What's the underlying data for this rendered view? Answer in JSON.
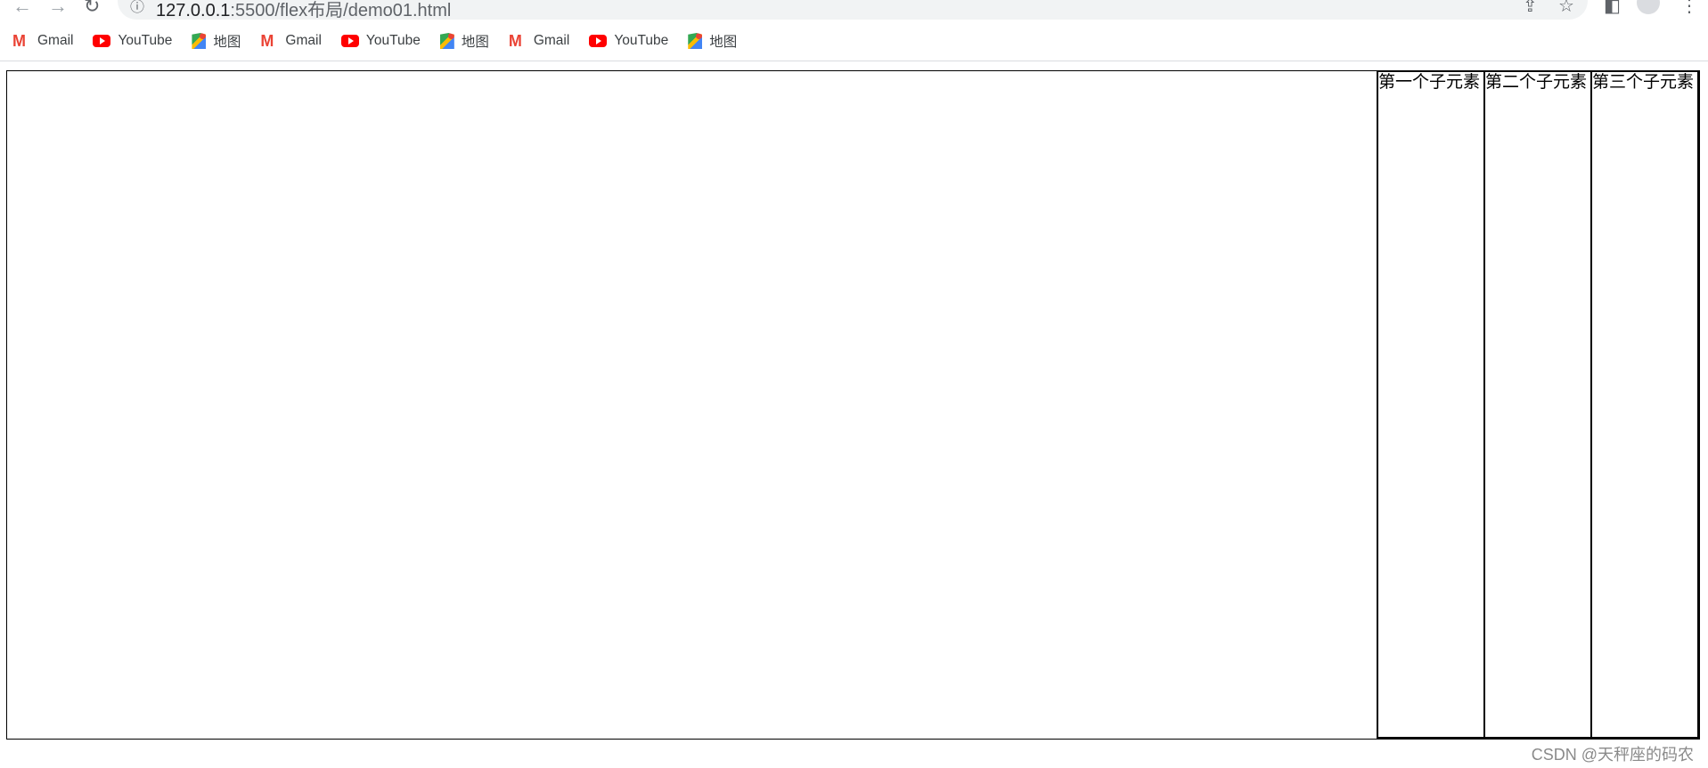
{
  "browser": {
    "url_host": "127.0.0.1",
    "url_rest": ":5500/flex布局/demo01.html",
    "bookmarks": [
      {
        "label": "Gmail",
        "icon": "gmail-icon"
      },
      {
        "label": "YouTube",
        "icon": "youtube-icon"
      },
      {
        "label": "地图",
        "icon": "maps-icon"
      },
      {
        "label": "Gmail",
        "icon": "gmail-icon"
      },
      {
        "label": "YouTube",
        "icon": "youtube-icon"
      },
      {
        "label": "地图",
        "icon": "maps-icon"
      },
      {
        "label": "Gmail",
        "icon": "gmail-icon"
      },
      {
        "label": "YouTube",
        "icon": "youtube-icon"
      },
      {
        "label": "地图",
        "icon": "maps-icon"
      }
    ]
  },
  "page": {
    "children": [
      "第一个子元素",
      "第二个子元素",
      "第三个子元素"
    ],
    "watermark": "CSDN @天秤座的码农"
  }
}
